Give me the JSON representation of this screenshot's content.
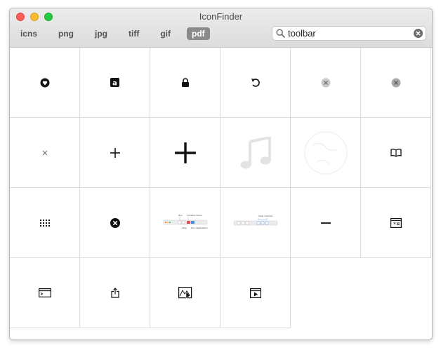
{
  "window": {
    "title": "IconFinder"
  },
  "tabs": [
    {
      "label": "icns",
      "active": false
    },
    {
      "label": "png",
      "active": false
    },
    {
      "label": "jpg",
      "active": false
    },
    {
      "label": "tiff",
      "active": false
    },
    {
      "label": "gif",
      "active": false
    },
    {
      "label": "pdf",
      "active": true
    }
  ],
  "search": {
    "value": "toolbar",
    "icon": "search-icon"
  },
  "icons": [
    {
      "name": "shield-heart-icon"
    },
    {
      "name": "text-a-icon"
    },
    {
      "name": "lock-icon"
    },
    {
      "name": "revert-icon"
    },
    {
      "name": "clear-gray-icon"
    },
    {
      "name": "clear-dark-gray-icon"
    },
    {
      "name": "small-x-icon"
    },
    {
      "name": "plus-icon"
    },
    {
      "name": "large-plus-icon"
    },
    {
      "name": "music-note-icon"
    },
    {
      "name": "faint-globe-icon"
    },
    {
      "name": "book-icon"
    },
    {
      "name": "grid-dots-icon"
    },
    {
      "name": "close-circle-icon"
    },
    {
      "name": "toolbar-diagram-thumbnail",
      "labels": [
        "Run",
        "Stop",
        "Scheme menu",
        "Run destination"
      ]
    },
    {
      "name": "view-controls-thumbnail",
      "labels": [
        "View controls"
      ]
    },
    {
      "name": "minus-icon"
    },
    {
      "name": "window-star-icon"
    },
    {
      "name": "terminal-window-icon"
    },
    {
      "name": "share-icon"
    },
    {
      "name": "image-cursor-icon"
    },
    {
      "name": "video-window-icon"
    }
  ],
  "colors": {
    "active_tab": "#8a8a8a",
    "traffic_close": "#fc5f57",
    "traffic_min": "#fdbc2e",
    "traffic_max": "#28c840"
  }
}
